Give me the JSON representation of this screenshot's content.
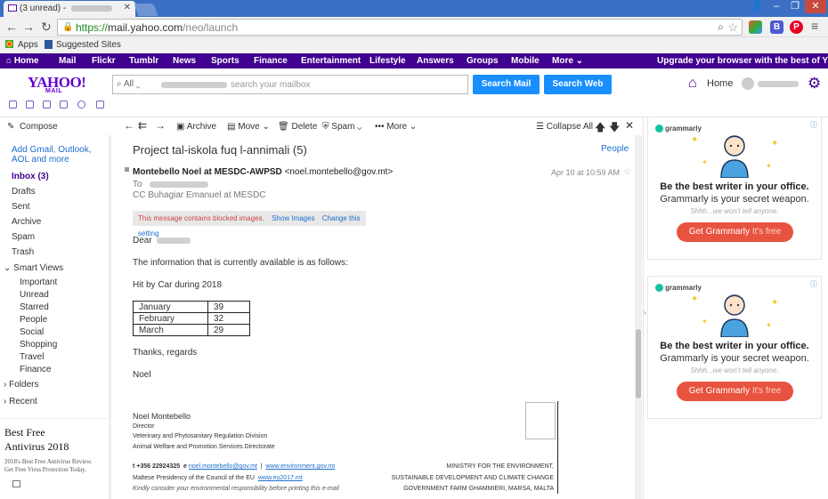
{
  "browser": {
    "tab_title": "(3 unread) -",
    "address": {
      "scheme": "https://",
      "host": "mail.yahoo.com",
      "path": "/neo/launch"
    },
    "bookmarks": [
      "Apps",
      "Suggested Sites"
    ],
    "ext_b": "B"
  },
  "ynav": {
    "items": [
      "Home",
      "Mail",
      "Flickr",
      "Tumblr",
      "News",
      "Sports",
      "Finance",
      "Entertainment",
      "Lifestyle",
      "Answers",
      "Groups",
      "Mobile",
      "More"
    ],
    "upgrade": "Upgrade your browser with the best of Yahoo »"
  },
  "header": {
    "logo": "YAHOO!",
    "logo_sub": "MAIL",
    "search_scope": "All",
    "search_placeholder": "search your mailbox",
    "search_mail": "Search Mail",
    "search_web": "Search Web",
    "home": "Home"
  },
  "sidebar": {
    "compose": "Compose",
    "add_accounts": "Add Gmail, Outlook,",
    "add_accounts2": "AOL and more",
    "folders": [
      "Inbox (3)",
      "Drafts",
      "Sent",
      "Archive",
      "Spam",
      "Trash"
    ],
    "smart_views": "Smart Views",
    "smart_items": [
      "Important",
      "Unread",
      "Starred",
      "People",
      "Social",
      "Shopping",
      "Travel",
      "Finance"
    ],
    "folders_label": "Folders",
    "recent": "Recent",
    "ad_title1": "Best Free",
    "ad_title2": "Antivirus 2018",
    "ad_text1": "2018's Best Free Antivirus Review.",
    "ad_text2": "Get Free Virus Protection Today."
  },
  "toolbar": {
    "archive": "Archive",
    "move": "Move",
    "delete": "Delete",
    "spam": "Spam",
    "more": "More",
    "collapse": "Collapse All"
  },
  "message": {
    "subject": "Project tal-iskola fuq l-annimali (5)",
    "people": "People",
    "from_name": "Montebello Noel at MESDC-AWPSD",
    "from_email": "<noel.montebello@gov.mt>",
    "date": "Apr 10 at 10:59 AM",
    "to_label": "To",
    "cc": "CC  Buhagiar Emanuel at MESDC",
    "blocked": "This message contains blocked images.",
    "show_images": "Show Images",
    "change_setting": "Change this setting",
    "dear": "Dear",
    "line1": "The information that is currently available is as follows:",
    "line2": "Hit by Car during  2018",
    "table": [
      [
        "January",
        "39"
      ],
      [
        "February",
        "32"
      ],
      [
        "March",
        "29"
      ]
    ],
    "thanks": "Thanks, regards",
    "sign": "Noel",
    "sig_name": "Noel Montebello",
    "sig_title": "Director",
    "sig_dept1": "Veterinary and Phytosanitary Regulation Division",
    "sig_dept2": "Animal Welfare and Promotion Services Directorate",
    "sig_t": "t  +356 22924325",
    "sig_e_label": "e",
    "sig_email": "noel.montebello@gov.mt",
    "sig_web": "www.environment.gov.mt",
    "sig_eu": "Maltese Presidency of the Council of the EU",
    "sig_eu_web": "www.eu2017.mt",
    "sig_env": "Kindly consider your environmental responsibility before printing this e-mail",
    "ministry1": "MINISTRY FOR THE ENVIRONMENT,",
    "ministry2": "SUSTAINABLE DEVELOPMENT AND CLIMATE CHANGE",
    "ministry3": "GOVERNMENT FARM GHAMMIERI, MARSA, MALTA"
  },
  "ads": {
    "brand": "grammarly",
    "headline": "Be the best writer in your office.",
    "subline": "Grammarly is your secret weapon.",
    "small": "Shhh...we won't tell anyone.",
    "cta": "Get Grammarly",
    "cta_free": "It's free"
  },
  "colors": {
    "yahoo_purple": "#400090",
    "search_blue": "#198fff",
    "link_blue": "#1a6fcf",
    "grammarly_red": "#e8533f"
  }
}
